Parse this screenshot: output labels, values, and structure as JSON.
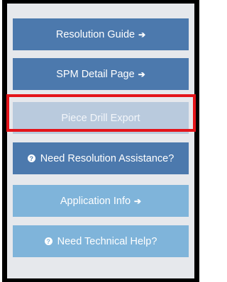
{
  "menu": {
    "resolution_guide": {
      "label": "Resolution Guide",
      "arrow": "➔"
    },
    "spm_detail_page": {
      "label": "SPM Detail Page",
      "arrow": "➔"
    },
    "piece_drill_export": {
      "label": "Piece Drill Export"
    },
    "need_resolution_assistance": {
      "icon": "?",
      "label": "Need Resolution Assistance?"
    },
    "application_info": {
      "label": "Application Info",
      "arrow": "➔"
    },
    "need_technical_help": {
      "icon": "?",
      "label": "Need Technical Help?"
    }
  },
  "colors": {
    "dark_button": "#4c79ad",
    "light_button": "#7fb4da",
    "disabled_button": "#b9cadd",
    "highlight_border": "#e4141a",
    "panel_background": "#e6e8ec",
    "frame": "#000000"
  },
  "icons": {
    "arrow": "right-arrow-icon",
    "help": "question-circle-icon"
  }
}
